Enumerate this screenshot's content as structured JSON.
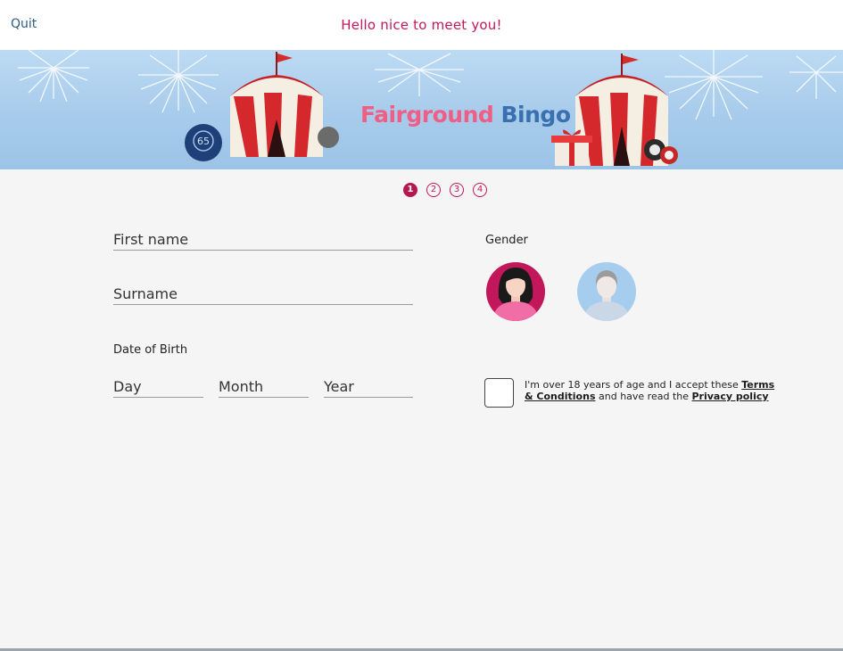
{
  "header": {
    "quit_label": "Quit",
    "greeting": "Hello nice to meet you!"
  },
  "banner": {
    "logo_part1": "Fairground",
    "logo_part2": "Bingo",
    "ball_number": "65",
    "colors": {
      "logo_pink": "#ef5e85",
      "logo_blue": "#3a6fb0",
      "sky": "#a7cbeb"
    }
  },
  "stepper": {
    "steps": [
      "1",
      "2",
      "3",
      "4"
    ],
    "current": 1
  },
  "form": {
    "first_name_placeholder": "First name",
    "surname_placeholder": "Surname",
    "dob_label": "Date of Birth",
    "day_placeholder": "Day",
    "month_placeholder": "Month",
    "year_placeholder": "Year",
    "gender_label": "Gender",
    "gender_options": [
      "female",
      "male"
    ],
    "terms_text_1": "I'm over 18 years of age and I accept these ",
    "terms_link": "Terms & Conditions",
    "terms_text_2": " and have read the ",
    "privacy_link": "Privacy policy"
  },
  "theme": {
    "accent": "#c2185b",
    "quit_color": "#2e5c86",
    "background": "#f5f5f5"
  }
}
